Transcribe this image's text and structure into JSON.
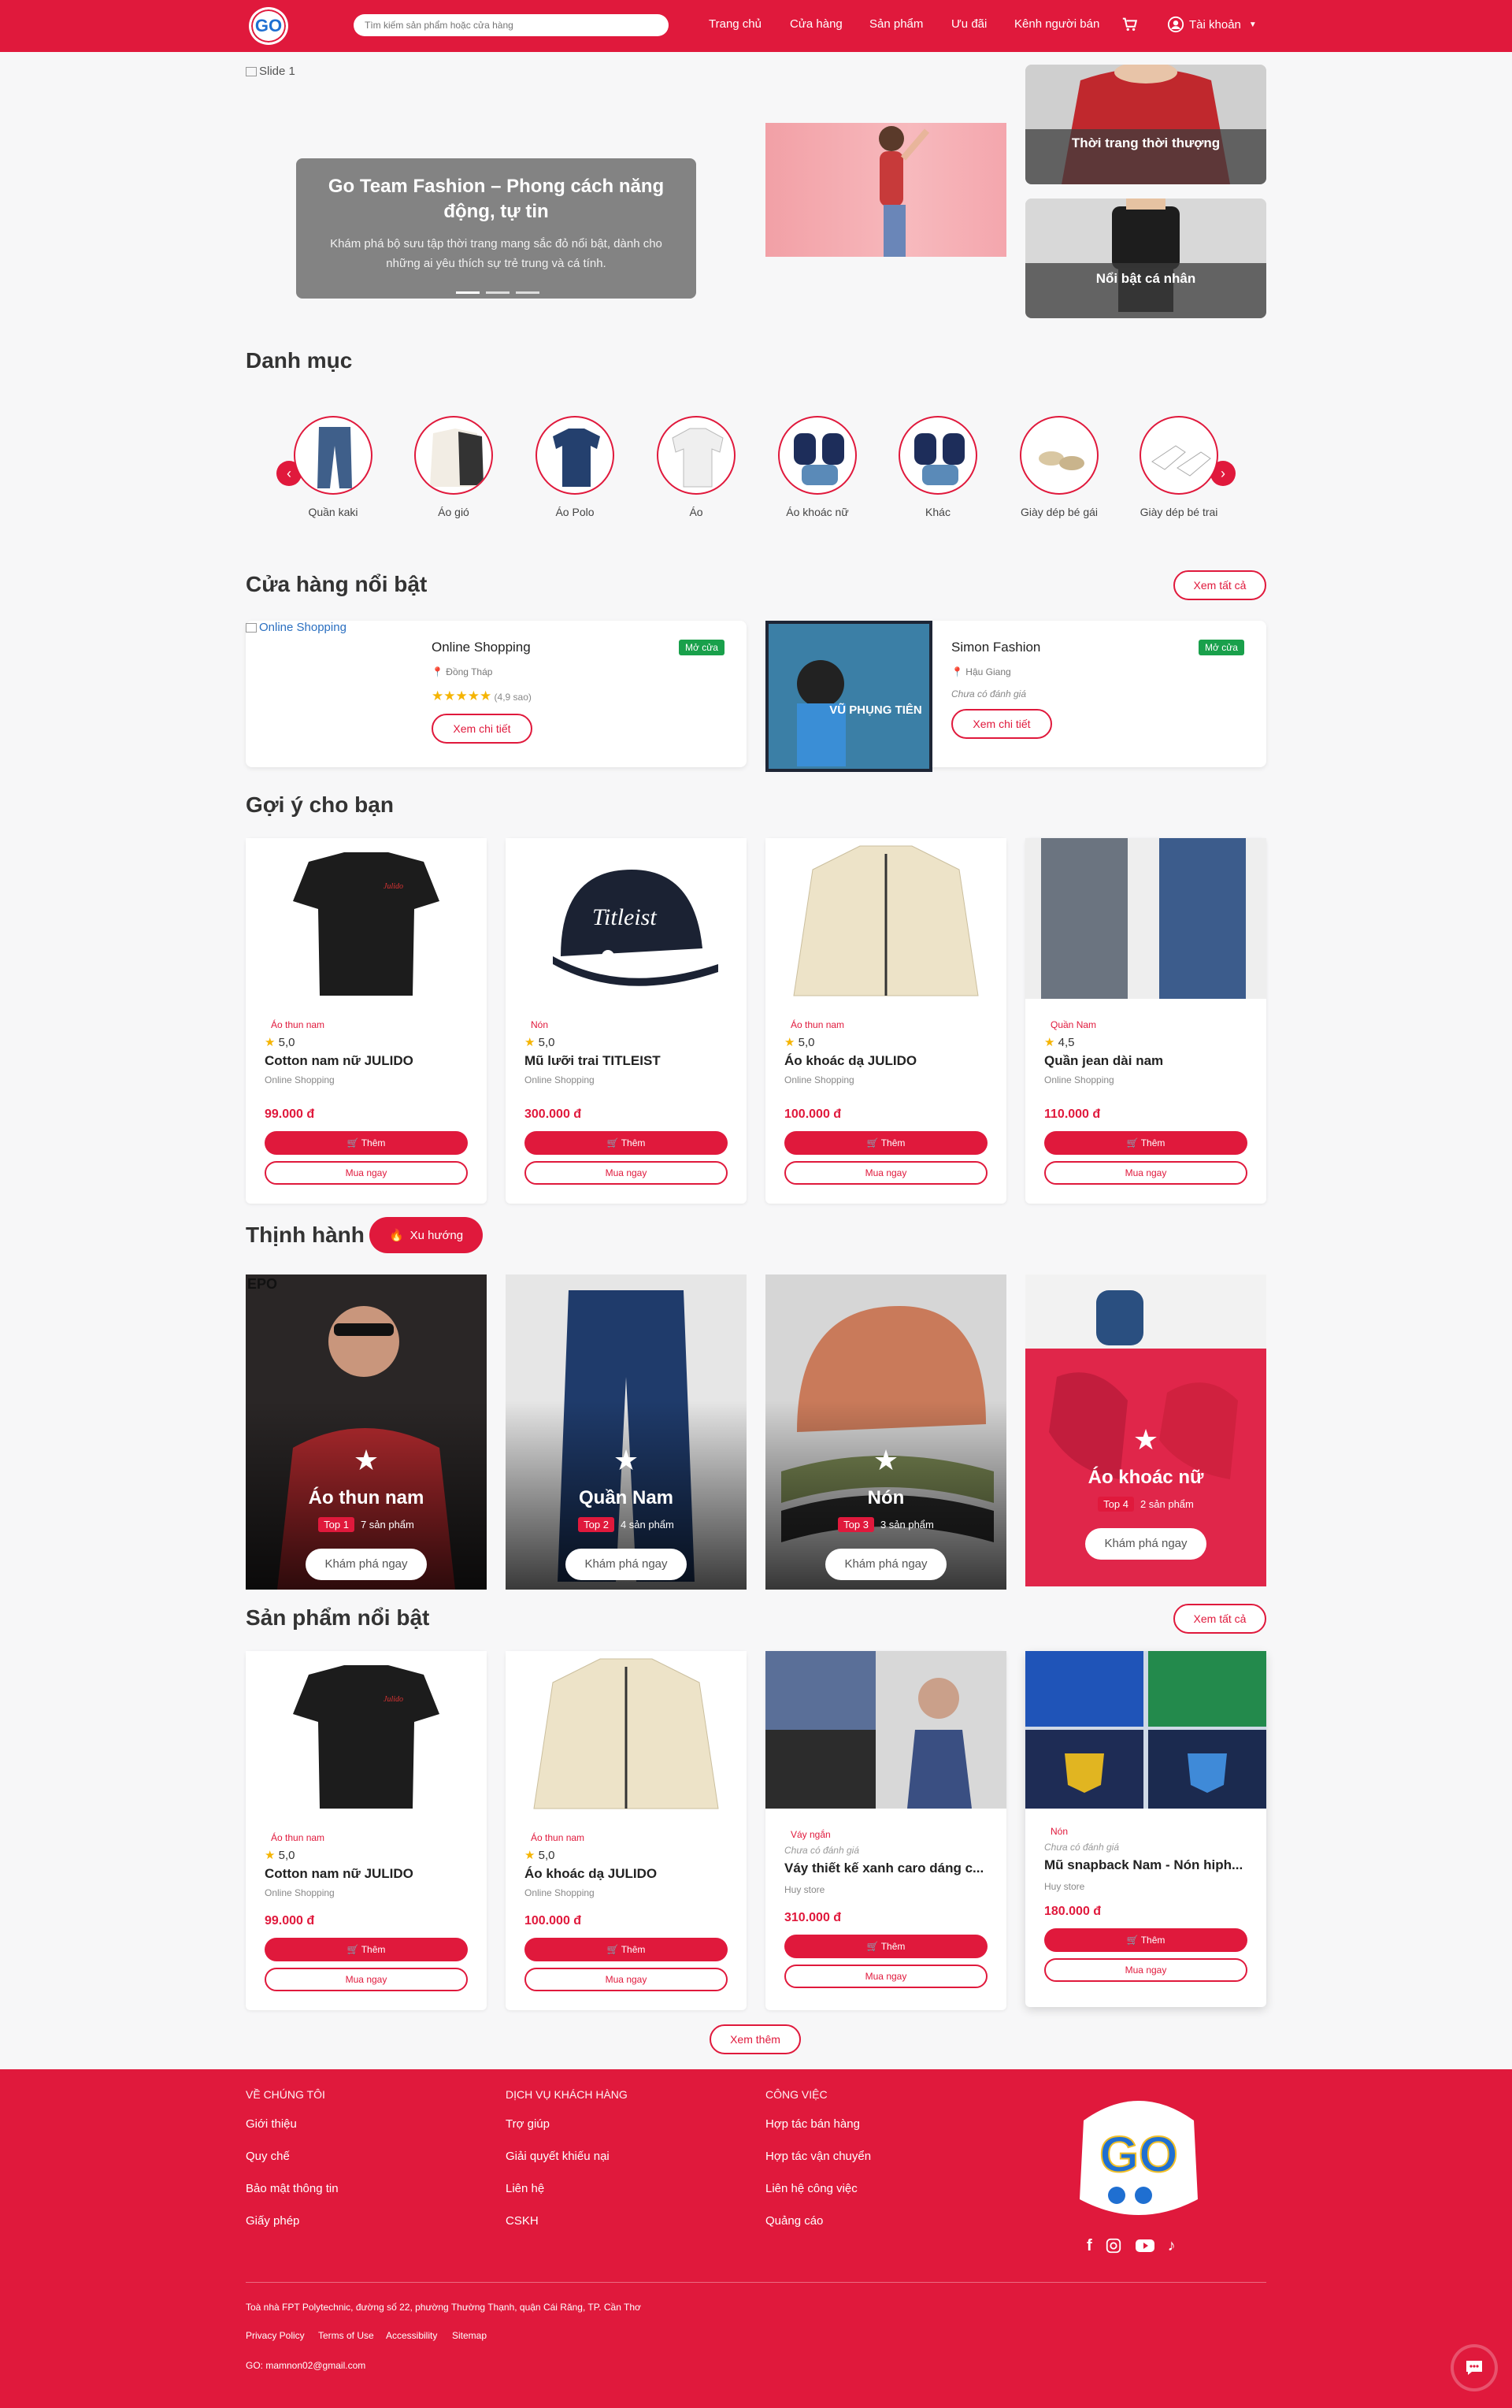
{
  "header": {
    "search_placeholder": "Tìm kiếm sản phẩm hoặc cửa hàng",
    "nav": [
      "Trang chủ",
      "Cửa hàng",
      "Sản phẩm",
      "Ưu đãi",
      "Kênh người bán"
    ],
    "account_label": "Tài khoản",
    "brand_color": "#e0193c"
  },
  "hero": {
    "image_alt": "Slide 1",
    "caption_title": "Go Team Fashion – Phong cách năng động, tự tin",
    "caption_text": "Khám phá bộ sưu tập thời trang mang sắc đỏ nổi bật, dành cho những ai yêu thích sự trẻ trung và cá tính.",
    "side_cards": [
      "Thời trang thời thượng",
      "Nổi bật cá nhân"
    ]
  },
  "categories": {
    "title": "Danh mục",
    "items": [
      "Quần kaki",
      "Áo gió",
      "Áo Polo",
      "Áo",
      "Áo khoác nữ",
      "Khác",
      "Giày dép bé gái",
      "Giày dép bé trai"
    ]
  },
  "shops": {
    "title": "Cửa hàng nổi bật",
    "see_all": "Xem tất cả",
    "items": [
      {
        "image_alt": "Online Shopping",
        "name": "Online Shopping",
        "location": "Đồng Tháp",
        "rating_text": "(4,9 sao)",
        "status": "Mở cửa",
        "button": "Xem chi tiết",
        "rating": 4.9
      },
      {
        "name": "Simon Fashion",
        "location": "Hậu Giang",
        "rating_text": "Chưa có đánh giá",
        "status": "Mở cửa",
        "button": "Xem chi tiết",
        "banner_text": "VŨ PHỤNG TIÊN"
      }
    ]
  },
  "suggest": {
    "title": "Gợi ý cho bạn",
    "items": [
      {
        "category": "Áo thun nam",
        "rating": "5,0",
        "name": "Cotton nam nữ JULIDO",
        "shop": "Online Shopping",
        "price": "99.000 đ"
      },
      {
        "category": "Nón",
        "rating": "5,0",
        "name": "Mũ lưỡi trai TITLEIST",
        "shop": "Online Shopping",
        "price": "300.000 đ"
      },
      {
        "category": "Áo thun nam",
        "rating": "5,0",
        "name": "Áo khoác dạ JULIDO",
        "shop": "Online Shopping",
        "price": "100.000 đ"
      },
      {
        "category": "Quần Nam",
        "rating": "4,5",
        "name": "Quần jean dài nam",
        "shop": "Online Shopping",
        "price": "110.000 đ"
      }
    ],
    "add_label": "Thêm",
    "buy_label": "Mua ngay"
  },
  "trending": {
    "title": "Thịnh hành",
    "pill": "Xu hướng",
    "explore": "Khám phá ngay",
    "items": [
      {
        "name": "Áo thun nam",
        "rank": "Top 1",
        "count": "7 sản phẩm",
        "corner_text": "EPO"
      },
      {
        "name": "Quần Nam",
        "rank": "Top 2",
        "count": "4 sản phẩm"
      },
      {
        "name": "Nón",
        "rank": "Top 3",
        "count": "3 sản phẩm"
      },
      {
        "name": "Áo khoác nữ",
        "rank": "Top 4",
        "count": "2 sản phẩm"
      }
    ]
  },
  "featured": {
    "title": "Sản phẩm nổi bật",
    "see_all": "Xem tất cả",
    "items": [
      {
        "category": "Áo thun nam",
        "rating": "5,0",
        "name": "Cotton nam nữ JULIDO",
        "shop": "Online Shopping",
        "price": "99.000 đ"
      },
      {
        "category": "Áo thun nam",
        "rating": "5,0",
        "name": "Áo khoác dạ JULIDO",
        "shop": "Online Shopping",
        "price": "100.000 đ"
      },
      {
        "category": "Váy ngắn",
        "note": "Chưa có đánh giá",
        "name": "Váy thiết kế xanh caro dáng c...",
        "shop": "Huy store",
        "price": "310.000 đ"
      },
      {
        "category": "Nón",
        "note": "Chưa có đánh giá",
        "name": "Mũ snapback Nam - Nón hiph...",
        "shop": "Huy store",
        "price": "180.000 đ"
      }
    ],
    "more": "Xem thêm"
  },
  "footer": {
    "col1_title": "VỀ CHÚNG TÔI",
    "col1": [
      "Giới thiệu",
      "Quy chế",
      "Bảo mật thông tin",
      "Giấy phép"
    ],
    "col2_title": "DỊCH VỤ KHÁCH HÀNG",
    "col2": [
      "Trợ giúp",
      "Giải quyết khiếu nại",
      "Liên hệ",
      "CSKH"
    ],
    "col3_title": "CÔNG VIỆC",
    "col3": [
      "Hợp tác bán hàng",
      "Hợp tác vận chuyển",
      "Liên hệ công việc",
      "Quảng cáo"
    ],
    "address": "Toà nhà FPT Polytechnic, đường số 22, phường Thường Thạnh, quận Cái Răng, TP. Cần Thơ",
    "links": [
      "Privacy Policy",
      "Terms of Use",
      "Accessibility",
      "Sitemap"
    ],
    "email": "GO: mamnon02@gmail.com",
    "logo_text": "GO"
  }
}
